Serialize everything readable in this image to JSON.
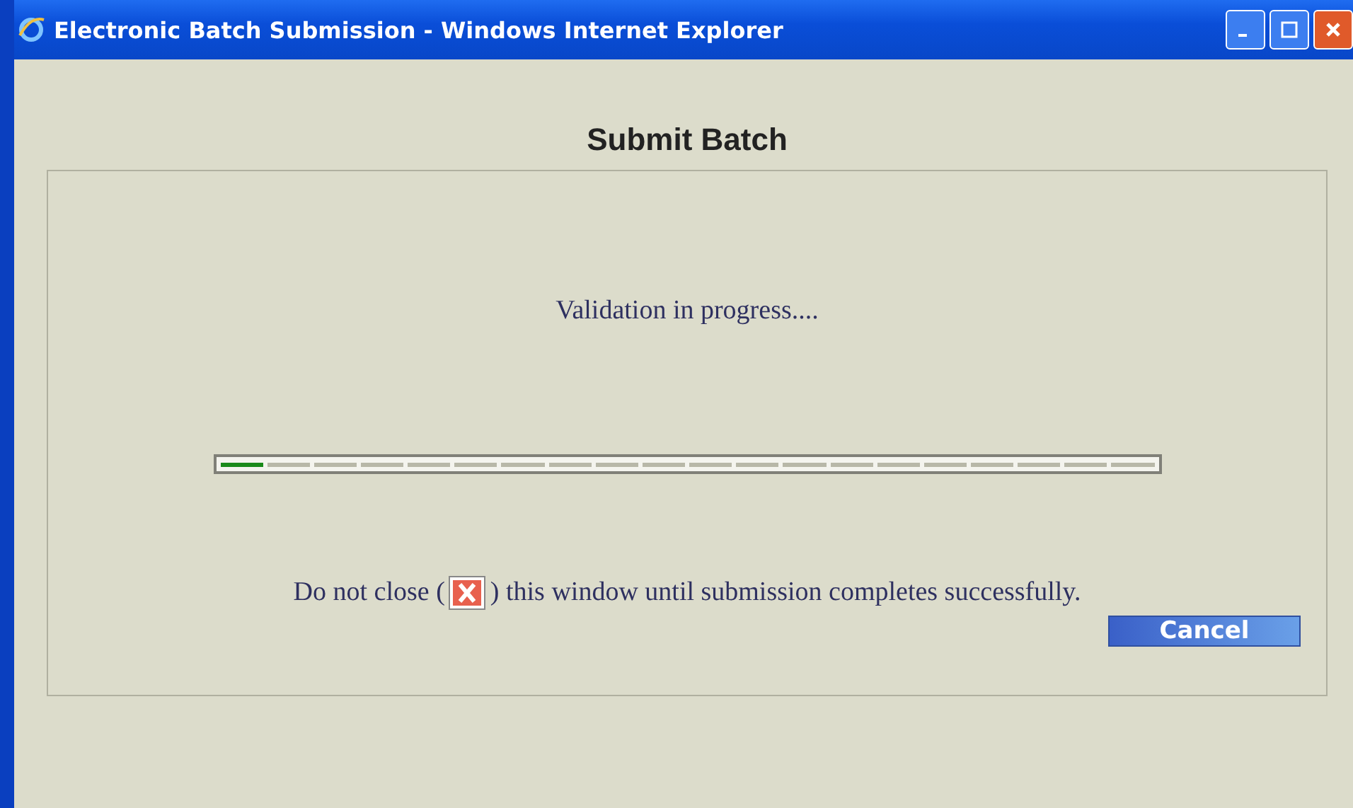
{
  "window": {
    "title": "Electronic Batch Submission - Windows Internet Explorer"
  },
  "heading": "Submit Batch",
  "status": "Validation in progress....",
  "progress": {
    "level": 0.05
  },
  "notice": {
    "before": "Do not close (",
    "after": ") this window until submission completes successfully."
  },
  "buttons": [
    "Cancel"
  ]
}
